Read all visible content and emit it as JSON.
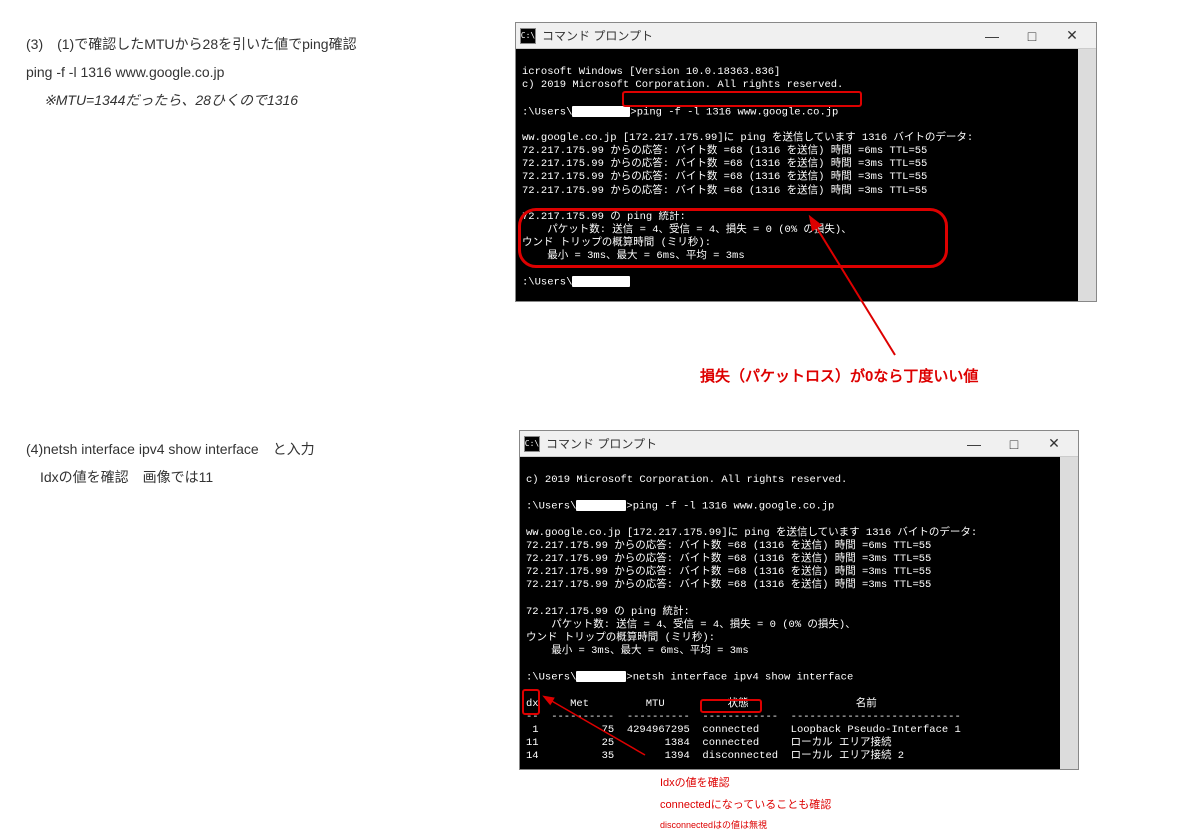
{
  "step3": {
    "title": "(3)　(1)で確認したMTUから28を引いた値でping確認",
    "command": "ping -f -l 1316 www.google.co.jp",
    "note": "※MTU=1344だったら、28ひくので1316"
  },
  "step4": {
    "title": "(4)netsh interface ipv4 show interface　と入力",
    "sub": "Idxの値を確認　画像では11"
  },
  "window_title": "コマンド プロンプト",
  "console1": {
    "line1": "icrosoft Windows [Version 10.0.18363.836]",
    "line2": "c) 2019 Microsoft Corporation. All rights reserved.",
    "prompt1a": ":\\Users\\",
    "prompt1b": ">ping -f -l 1316 www.google.co.jp",
    "line4": "ww.google.co.jp [172.217.175.99]に ping を送信しています 1316 バイトのデータ:",
    "line5": "72.217.175.99 からの応答: バイト数 =68 (1316 を送信) 時間 =6ms TTL=55",
    "line6": "72.217.175.99 からの応答: バイト数 =68 (1316 を送信) 時間 =3ms TTL=55",
    "line7": "72.217.175.99 からの応答: バイト数 =68 (1316 を送信) 時間 =3ms TTL=55",
    "line8": "72.217.175.99 からの応答: バイト数 =68 (1316 を送信) 時間 =3ms TTL=55",
    "line9": "72.217.175.99 の ping 統計:",
    "line10": "    パケット数: 送信 = 4、受信 = 4、損失 = 0 (0% の損失)、",
    "line11": "ウンド トリップの概算時間 (ミリ秒):",
    "line12": "    最小 = 3ms、最大 = 6ms、平均 = 3ms",
    "prompt2": ":\\Users\\"
  },
  "annotation1": "損失（パケットロス）が0なら丁度いい値",
  "console2": {
    "line1": "c) 2019 Microsoft Corporation. All rights reserved.",
    "prompt1a": ":\\Users\\",
    "prompt1b": ">ping -f -l 1316 www.google.co.jp",
    "line3": "ww.google.co.jp [172.217.175.99]に ping を送信しています 1316 バイトのデータ:",
    "line4": "72.217.175.99 からの応答: バイト数 =68 (1316 を送信) 時間 =6ms TTL=55",
    "line5": "72.217.175.99 からの応答: バイト数 =68 (1316 を送信) 時間 =3ms TTL=55",
    "line6": "72.217.175.99 からの応答: バイト数 =68 (1316 を送信) 時間 =3ms TTL=55",
    "line7": "72.217.175.99 からの応答: バイト数 =68 (1316 を送信) 時間 =3ms TTL=55",
    "line8": "72.217.175.99 の ping 統計:",
    "line9": "    パケット数: 送信 = 4、受信 = 4、損失 = 0 (0% の損失)、",
    "line10": "ウンド トリップの概算時間 (ミリ秒):",
    "line11": "    最小 = 3ms、最大 = 6ms、平均 = 3ms",
    "prompt2a": ":\\Users\\",
    "prompt2b": ">netsh interface ipv4 show interface",
    "header": "dx     Met         MTU          状態                 名前",
    "divider": "--  ----------  ----------  ------------  ---------------------------",
    "row1": " 1          75  4294967295  connected     Loopback Pseudo-Interface 1",
    "row2": "11          25        1384  connected     ローカル エリア接続",
    "row3": "14          35        1394  disconnected  ローカル エリア接続 2",
    "prompt3": ":\\Users\\"
  },
  "annotation2a": "Idxの値を確認",
  "annotation2b": "connectedになっていることも確認",
  "annotation2c": "disconnectedはの値は無視",
  "icons": {
    "cmd": "C:\\",
    "minimize": "―",
    "maximize": "□",
    "close": "✕"
  },
  "colors": {
    "red": "#d00"
  }
}
